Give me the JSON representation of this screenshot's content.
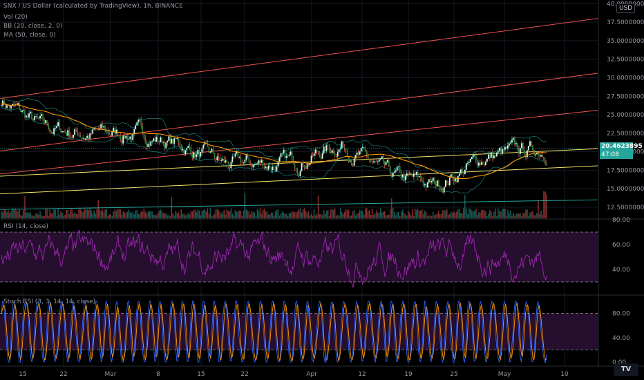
{
  "header": {
    "title": "SNX / US Dollar (calculated by TradingView), 1h, BINANCE",
    "indicators": [
      "Vol (20)",
      "BB (20, close, 2, 0)",
      "MA (50, close, 0)"
    ],
    "currency": "USD"
  },
  "price_tag": {
    "value": "20.4623895",
    "timer": "47:08"
  },
  "rsi_pane": {
    "legend": "RSI (14, close)"
  },
  "stoch_pane": {
    "legend": "Stoch RSI (3, 3, 14, 14, close)"
  },
  "colors": {
    "background": "#000000",
    "candle_up": "#26a69a",
    "candle_down": "#ef5350",
    "ma": "#ff9800",
    "bb": "#26a69a",
    "channel_red": "#ef5350",
    "channel_yellow": "#f5e663",
    "channel_green": "#26a69a",
    "rsi": "#9c27b0",
    "stoch_k": "#2962ff",
    "stoch_d": "#ff9800"
  },
  "chart_data": [
    {
      "type": "line",
      "title": "SNX / US Dollar (calculated by TradingView), 1h, BINANCE",
      "price_axis_ticks": [
        "40.0000000",
        "37.5000000",
        "35.0000000",
        "32.5000000",
        "30.0000000",
        "27.5000000",
        "25.0000000",
        "22.5000000",
        "20.0000000",
        "17.5000000",
        "15.0000000",
        "12.5000000"
      ],
      "ylim": [
        11,
        40.5
      ],
      "time_axis_ticks": [
        "15",
        "22",
        "Mar",
        "8",
        "15",
        "22",
        "Apr",
        "12",
        "19",
        "25",
        "May",
        "10"
      ],
      "last_price": 20.4623895,
      "x": [
        "15",
        "22",
        "Mar",
        "8",
        "15",
        "22",
        "Apr",
        "12",
        "19",
        "25",
        "May",
        "10"
      ],
      "series": [
        {
          "values": [
            27.0,
            23.2,
            22.4,
            22.5,
            20.9,
            18.2,
            18.5,
            21.1,
            16.5,
            15.4,
            19.3,
            20.5
          ]
        }
      ],
      "channels": [
        {
          "color": "red",
          "from": [
            27.2,
            "15"
          ],
          "to": [
            38.0,
            "10"
          ]
        },
        {
          "color": "red",
          "from": [
            20.1,
            "15"
          ],
          "to": [
            30.6,
            "10"
          ]
        },
        {
          "color": "red",
          "from": [
            17.0,
            "15"
          ],
          "to": [
            25.6,
            "10"
          ]
        },
        {
          "color": "yellow",
          "from": [
            16.7,
            "15"
          ],
          "to": [
            20.4,
            "10"
          ]
        },
        {
          "color": "yellow",
          "from": [
            14.3,
            "15"
          ],
          "to": [
            18.1,
            "10"
          ]
        },
        {
          "color": "green",
          "from": [
            12.2,
            "15"
          ],
          "to": [
            13.5,
            "10"
          ]
        }
      ]
    },
    {
      "type": "line",
      "ylim": [
        20,
        80
      ],
      "yticks": [
        "80.00",
        "60.00",
        "40.00"
      ],
      "bands": [
        30,
        70
      ]
    },
    {
      "type": "line",
      "ylim": [
        0,
        100
      ],
      "yticks": [
        "80.00",
        "40.00",
        "0.00"
      ],
      "bands": [
        20,
        80
      ]
    }
  ]
}
